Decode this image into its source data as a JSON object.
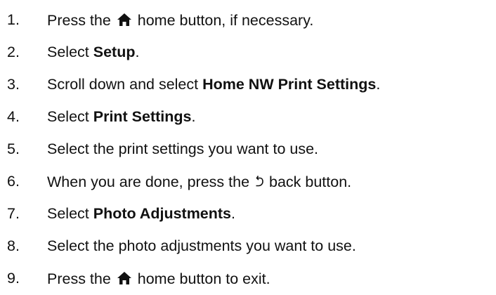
{
  "steps": [
    {
      "number": "1.",
      "parts": [
        {
          "text": "Press the "
        },
        {
          "icon": "home-icon"
        },
        {
          "text": " home button, if necessary."
        }
      ]
    },
    {
      "number": "2.",
      "parts": [
        {
          "text": "Select "
        },
        {
          "bold": "Setup"
        },
        {
          "text": "."
        }
      ]
    },
    {
      "number": "3.",
      "parts": [
        {
          "text": "Scroll down and select "
        },
        {
          "bold": "Home NW Print Settings"
        },
        {
          "text": "."
        }
      ]
    },
    {
      "number": "4.",
      "parts": [
        {
          "text": "Select "
        },
        {
          "bold": "Print Settings"
        },
        {
          "text": "."
        }
      ]
    },
    {
      "number": "5.",
      "parts": [
        {
          "text": "Select the print settings you want to use."
        }
      ]
    },
    {
      "number": "6.",
      "parts": [
        {
          "text": "When you are done, press the "
        },
        {
          "icon": "back-icon"
        },
        {
          "text": " back button."
        }
      ]
    },
    {
      "number": "7.",
      "parts": [
        {
          "text": "Select "
        },
        {
          "bold": "Photo Adjustments"
        },
        {
          "text": "."
        }
      ]
    },
    {
      "number": "8.",
      "parts": [
        {
          "text": "Select the photo adjustments you want to use."
        }
      ]
    },
    {
      "number": "9.",
      "parts": [
        {
          "text": "Press the "
        },
        {
          "icon": "home-icon"
        },
        {
          "text": " home button to exit."
        }
      ]
    }
  ]
}
